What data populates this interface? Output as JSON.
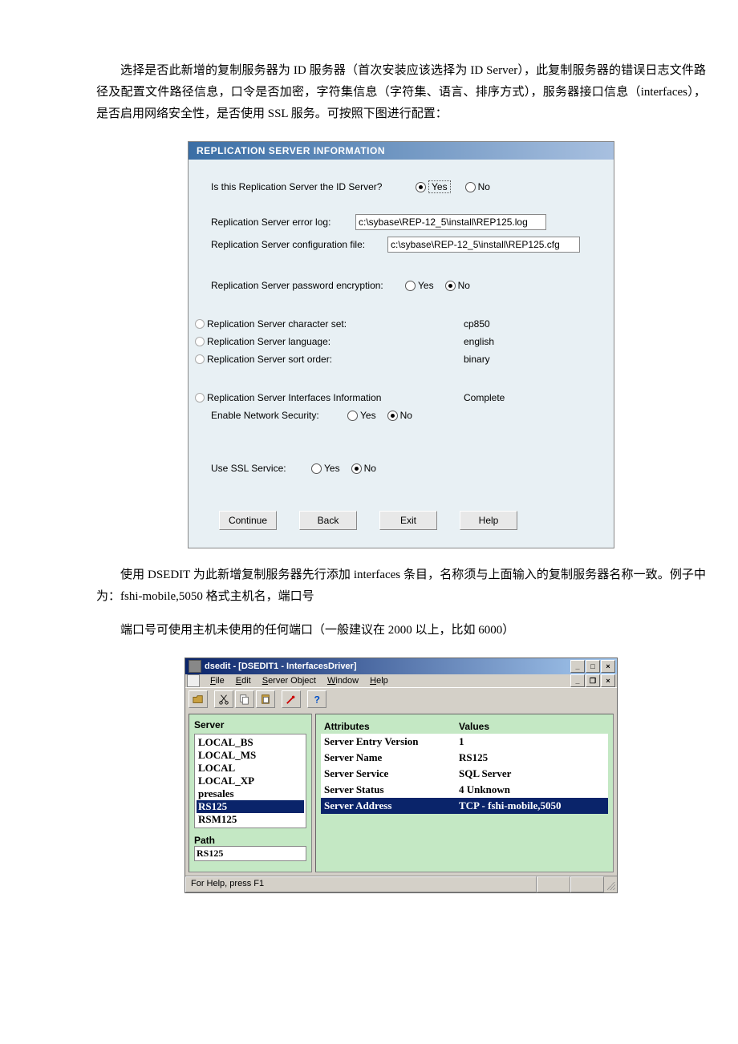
{
  "doc": {
    "p1": "选择是否此新增的复制服务器为 ID 服务器（首次安装应该选择为 ID Server），此复制服务器的错误日志文件路径及配置文件路径信息，口令是否加密，字符集信息（字符集、语言、排序方式），服务器接口信息（interfaces），是否启用网络安全性，是否使用 SSL 服务。可按照下图进行配置：",
    "p2": "使用 DSEDIT 为此新增复制服务器先行添加 interfaces 条目，名称须与上面输入的复制服务器名称一致。例子中为：fshi-mobile,5050     格式主机名，端口号",
    "p3": "端口号可使用主机未使用的任何端口（一般建议在 2000 以上，比如 6000）"
  },
  "rep": {
    "title": "REPLICATION SERVER INFORMATION",
    "q_id": "Is this Replication Server the ID Server?",
    "yes": "Yes",
    "no": "No",
    "err_log_label": "Replication Server error log:",
    "err_log_value": "c:\\sybase\\REP-12_5\\install\\REP125.log",
    "cfg_label": "Replication Server configuration file:",
    "cfg_value": "c:\\sybase\\REP-12_5\\install\\REP125.cfg",
    "pwd_label": "Replication Server password encryption:",
    "charset_label": "Replication Server character set:",
    "charset_value": "cp850",
    "lang_label": "Replication Server language:",
    "lang_value": "english",
    "sort_label": "Replication Server sort order:",
    "sort_value": "binary",
    "interfaces_label": "Replication Server Interfaces Information",
    "interfaces_value": "Complete",
    "netsec_label": "Enable Network Security:",
    "ssl_label": "Use SSL Service:",
    "btn_continue": "Continue",
    "btn_back": "Back",
    "btn_exit": "Exit",
    "btn_help": "Help"
  },
  "dse": {
    "title": "dsedit - [DSEDIT1 - InterfacesDriver]",
    "menu": {
      "file": "File",
      "edit": "Edit",
      "serverobj": "Server Object",
      "window": "Window",
      "help": "Help"
    },
    "left": {
      "header": "Server",
      "servers": [
        "LOCAL_BS",
        "LOCAL_MS",
        "LOCAL",
        "LOCAL_XP",
        "presales",
        "RS125",
        "RSM125"
      ],
      "selected": "RS125",
      "path_label": "Path",
      "path_value": "RS125"
    },
    "right": {
      "h1": "Attributes",
      "h2": "Values",
      "rows": [
        {
          "attr": "Server Entry Version",
          "val": "1"
        },
        {
          "attr": "Server Name",
          "val": "RS125"
        },
        {
          "attr": "Server Service",
          "val": "SQL Server"
        },
        {
          "attr": "Server Status",
          "val": "4   Unknown"
        },
        {
          "attr": "Server Address",
          "val": "TCP - fshi-mobile,5050"
        }
      ]
    },
    "status": "For Help, press F1"
  }
}
